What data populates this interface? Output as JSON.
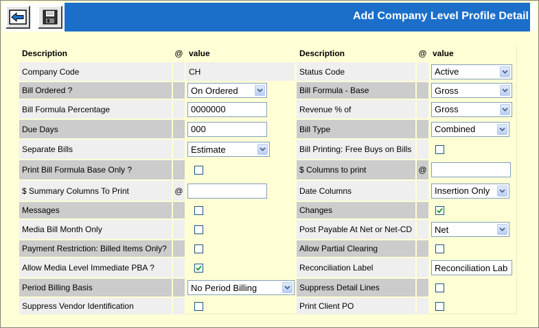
{
  "window": {
    "title": "Add Company Level Profile Detail"
  },
  "toolbar": {
    "back_icon": "back-arrow-icon",
    "save_icon": "save-disk-icon"
  },
  "headers": {
    "description": "Description",
    "at": "@",
    "value": "value",
    "description_right": "Description",
    "at_right": "@",
    "value_right": "value"
  },
  "left": {
    "company_code": {
      "label": "Company Code",
      "value": "CH"
    },
    "bill_ordered": {
      "label": "Bill Ordered ?",
      "value": "On Ordered"
    },
    "bill_formula_pct": {
      "label": "Bill Formula Percentage",
      "value": "0000000"
    },
    "due_days": {
      "label": "Due Days",
      "value": "000"
    },
    "separate_bills": {
      "label": "Separate Bills",
      "value": "Estimate"
    },
    "print_bill_formula": {
      "label": "Print Bill Formula Base Only ?",
      "checked": false
    },
    "summary_columns": {
      "label": "$ Summary Columns To Print",
      "at": "@",
      "value": ""
    },
    "messages": {
      "label": "Messages",
      "checked": false
    },
    "media_bill_month": {
      "label": "Media Bill Month Only",
      "checked": false
    },
    "payment_restriction": {
      "label": "Payment Restriction: Billed Items Only?",
      "checked": false
    },
    "allow_media_pba": {
      "label": "Allow Media Level Immediate PBA ?",
      "checked": true
    },
    "period_billing": {
      "label": "Period Billing Basis",
      "value": "No Period Billing"
    },
    "suppress_vendor": {
      "label": "Suppress Vendor Identification",
      "checked": false
    }
  },
  "right": {
    "status_code": {
      "label": "Status Code",
      "value": "Active"
    },
    "bill_formula_base": {
      "label": "Bill Formula - Base",
      "value": "Gross"
    },
    "revenue_pct": {
      "label": "Revenue % of",
      "value": "Gross"
    },
    "bill_type": {
      "label": "Bill Type",
      "value": "Combined"
    },
    "free_buys": {
      "label": "Bill Printing: Free Buys on Bills",
      "checked": false
    },
    "columns_to_print": {
      "label": "$ Columns to print",
      "at": "@",
      "value": ""
    },
    "date_columns": {
      "label": "Date Columns",
      "value": "Insertion Only"
    },
    "changes": {
      "label": "Changes",
      "checked": true
    },
    "post_payable": {
      "label": "Post Payable At Net or Net-CD",
      "value": "Net"
    },
    "allow_partial": {
      "label": "Allow Partial Clearing",
      "checked": false
    },
    "reconciliation_label": {
      "label": "Reconciliation Label",
      "value": "Reconciliation Lab"
    },
    "suppress_detail": {
      "label": "Suppress Detail Lines",
      "checked": false
    },
    "print_client_po": {
      "label": "Print Client PO",
      "checked": false
    }
  }
}
